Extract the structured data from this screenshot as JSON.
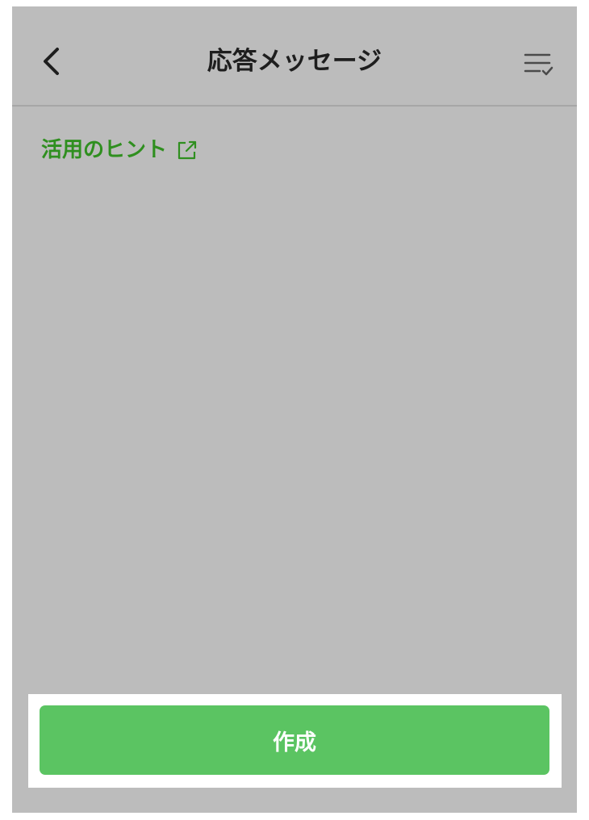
{
  "header": {
    "title": "応答メッセージ",
    "back_icon": "chevron-left-icon",
    "menu_icon": "list-check-icon"
  },
  "hint": {
    "label": "活用のヒント",
    "icon": "external-link-icon"
  },
  "footer": {
    "create_label": "作成"
  },
  "colors": {
    "background_overlay": "#bcbcbc",
    "accent_green": "#5bc462",
    "link_green": "#2f8f1f",
    "title_text": "#1e1e1e"
  }
}
